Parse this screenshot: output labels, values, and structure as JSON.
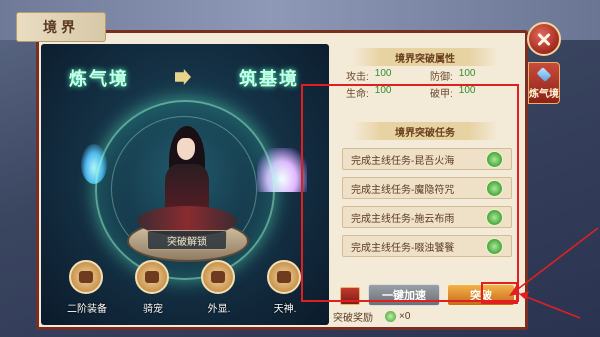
{
  "window": {
    "title": "境界"
  },
  "side_tab": {
    "label": "炼气境"
  },
  "scene": {
    "realm_current": "炼气境",
    "realm_next": "筑基境",
    "unlock_label": "突破解锁",
    "rewards": [
      {
        "label": "二阶装备",
        "icon": "equipment-icon"
      },
      {
        "label": "骑宠",
        "icon": "mount-icon"
      },
      {
        "label": "外显.",
        "icon": "wings-icon"
      },
      {
        "label": "天神.",
        "icon": "temple-icon"
      }
    ]
  },
  "attributes": {
    "title": "境界突破属性",
    "rows": [
      [
        {
          "key": "攻击:",
          "value": "100"
        },
        {
          "key": "防御:",
          "value": "100"
        }
      ],
      [
        {
          "key": "生命:",
          "value": "100"
        },
        {
          "key": "破甲:",
          "value": "100"
        }
      ]
    ]
  },
  "tasks": {
    "title": "境界突破任务",
    "items": [
      {
        "label": "完成主线任务-昆吾火海"
      },
      {
        "label": "完成主线任务-魔隐符咒"
      },
      {
        "label": "完成主线任务-施云布雨"
      },
      {
        "label": "完成主线任务-啜浊饕餮"
      }
    ]
  },
  "actions": {
    "quick_label": "一键加速",
    "break_label": "突破"
  },
  "reward": {
    "label": "突破奖励",
    "count": "×0"
  },
  "colors": {
    "frame": "#7a2e22",
    "attr_value": "#2f8f2a",
    "annotation": "#e02020"
  }
}
